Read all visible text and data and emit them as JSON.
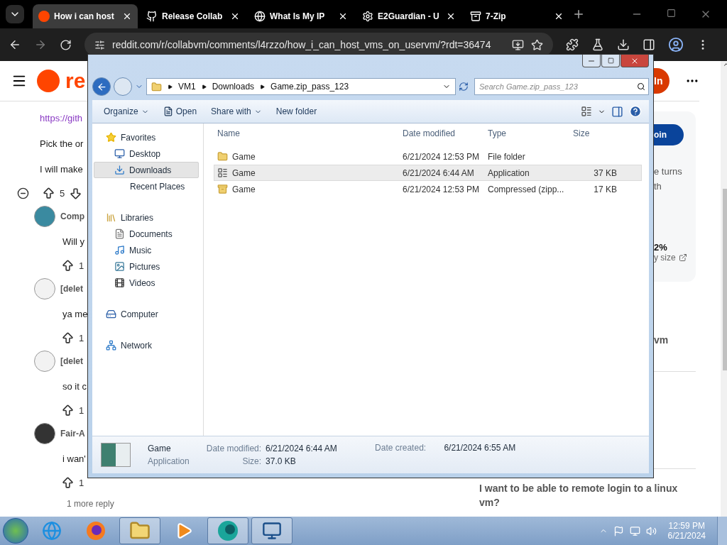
{
  "browser": {
    "tabs": [
      {
        "title": "How i can host",
        "kind": "reddit",
        "selected": true
      },
      {
        "title": "Release Collab",
        "kind": "github",
        "selected": false
      },
      {
        "title": "What Is My IP",
        "kind": "globe",
        "selected": false
      },
      {
        "title": "E2Guardian - U",
        "kind": "gear",
        "selected": false
      },
      {
        "title": "7-Zip",
        "kind": "zip",
        "selected": false
      }
    ],
    "url": "reddit.com/r/collabvm/comments/l4rzzo/how_i_can_host_vms_on_uservm/?rdt=36474"
  },
  "reddit": {
    "logo": "re",
    "login": "In",
    "post": {
      "lines": [
        {
          "kind": "link",
          "text": "https://gith"
        },
        {
          "kind": "text",
          "text": "Pick the or"
        },
        {
          "kind": "text",
          "text": "I will make"
        }
      ],
      "votes": "5"
    },
    "comments": [
      {
        "author": "Comp",
        "body": "Will y",
        "votes": "1",
        "color": "#3a8aa0"
      },
      {
        "author": "[delet",
        "body": "ya me",
        "votes": "1",
        "color": "#f2f2f2"
      },
      {
        "author": "[delet",
        "body": "so it c",
        "votes": "1",
        "color": "#f2f2f2"
      },
      {
        "author": "Fair-A",
        "body": "i wan'",
        "votes": "1",
        "color": "#333333",
        "more": "1 more reply"
      }
    ],
    "sidebar": {
      "join": "oin",
      "lines": [
        "e turns",
        "th"
      ],
      "stat": "2%",
      "stat_label": "y size",
      "related": "vm",
      "question": "I want to be able to remote login to a linux vm?"
    }
  },
  "explorer": {
    "path": [
      "VM1",
      "Downloads",
      "Game.zip_pass_123"
    ],
    "search": {
      "placeholder": "Search Game.zip_pass_123"
    },
    "toolbar": [
      {
        "label": "Organize",
        "kind": "menu"
      },
      {
        "label": "Open",
        "kind": "open"
      },
      {
        "label": "Share with",
        "kind": "menu"
      },
      {
        "label": "New folder",
        "kind": "plain"
      }
    ],
    "nav": [
      {
        "label": "Favorites",
        "kind": "star",
        "selected": false,
        "children": [
          {
            "label": "Desktop",
            "kind": "desktop",
            "selected": false
          },
          {
            "label": "Downloads",
            "kind": "downloads",
            "selected": true
          },
          {
            "label": "Recent Places",
            "kind": "recent",
            "selected": false
          }
        ]
      },
      {
        "label": "Libraries",
        "kind": "library",
        "selected": false,
        "children": [
          {
            "label": "Documents",
            "kind": "doc",
            "selected": false
          },
          {
            "label": "Music",
            "kind": "music",
            "selected": false
          },
          {
            "label": "Pictures",
            "kind": "pictures",
            "selected": false
          },
          {
            "label": "Videos",
            "kind": "videos",
            "selected": false
          }
        ]
      },
      {
        "label": "Computer",
        "kind": "computer",
        "selected": false
      },
      {
        "label": "Network",
        "kind": "network",
        "selected": false
      }
    ],
    "columns": [
      "Name",
      "Date modified",
      "Type",
      "Size"
    ],
    "files": [
      {
        "name": "Game",
        "kind": "folder",
        "modified": "6/21/2024 12:53 PM",
        "type": "File folder",
        "selected": false
      },
      {
        "name": "Game",
        "kind": "app",
        "modified": "6/21/2024 6:44 AM",
        "type": "Application",
        "size": "37 KB",
        "selected": true
      },
      {
        "name": "Game",
        "kind": "zip",
        "modified": "6/21/2024 12:53 PM",
        "type": "Compressed (zipp...",
        "size": "17 KB",
        "selected": false
      }
    ],
    "details": {
      "name": "Game",
      "type": "Application",
      "fields": [
        {
          "label": "Date modified:",
          "value": "6/21/2024 6:44 AM"
        },
        {
          "label": "Size:",
          "value": "37.0 KB"
        },
        {
          "label": "Date created:",
          "value": "6/21/2024 6:55 AM"
        }
      ]
    }
  },
  "taskbar": {
    "apps": [
      {
        "kind": "ie",
        "active": false
      },
      {
        "kind": "firefox",
        "active": false
      },
      {
        "kind": "folder",
        "active": true
      },
      {
        "kind": "media",
        "active": false
      },
      {
        "kind": "teal",
        "active": true
      },
      {
        "kind": "installer",
        "active": true
      }
    ],
    "time": "12:59 PM",
    "date": "6/21/2024"
  }
}
